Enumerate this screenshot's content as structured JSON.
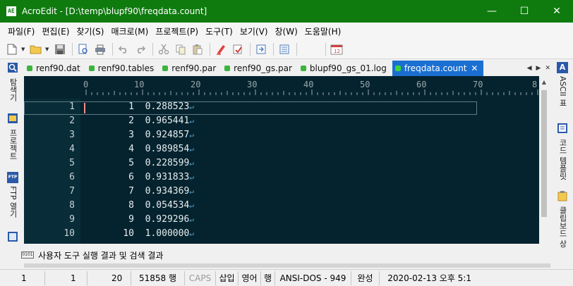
{
  "window": {
    "app_icon_text": "AE",
    "title": "AcroEdit - [D:\\temp\\blupf90\\freqdata.count]",
    "minimize": "—",
    "maximize": "☐",
    "close": "✕"
  },
  "menu": {
    "items": [
      "파일(F)",
      "편집(E)",
      "찾기(S)",
      "매크로(M)",
      "프로젝트(P)",
      "도구(T)",
      "보기(V)",
      "창(W)",
      "도움말(H)"
    ]
  },
  "left_panel": {
    "items": [
      {
        "label": "탐색기",
        "icon": "magnifier-icon"
      },
      {
        "label": "프로젝트",
        "icon": "project-icon"
      },
      {
        "label": "FTP 열기",
        "icon": "ftp-icon"
      }
    ],
    "ftp_icon_text": "FTP"
  },
  "right_panel": {
    "items": [
      {
        "label": "ASCII 표",
        "icon": "ascii-icon"
      },
      {
        "label": "코드 템플릿",
        "icon": "template-icon"
      },
      {
        "label": "클립보드 상",
        "icon": "clipboard-icon"
      }
    ],
    "ascii_icon_text": "A"
  },
  "tabs": [
    {
      "label": "renf90.dat",
      "active": false
    },
    {
      "label": "renf90.tables",
      "active": false
    },
    {
      "label": "renf90.par",
      "active": false
    },
    {
      "label": "renf90_gs.par",
      "active": false
    },
    {
      "label": "blupf90_gs_01.log",
      "active": false
    },
    {
      "label": "freqdata.count",
      "active": true
    }
  ],
  "tab_nav": {
    "prev": "◀",
    "next": "▶",
    "close": "✕"
  },
  "ruler": {
    "labels": [
      "0",
      "10",
      "20",
      "30",
      "40",
      "50",
      "60",
      "70",
      "8"
    ]
  },
  "editor": {
    "line_numbers": [
      "1",
      "2",
      "3",
      "4",
      "5",
      "6",
      "7",
      "8",
      "9",
      "10"
    ],
    "lines": [
      {
        "id": "1",
        "freq": "0.288523"
      },
      {
        "id": "2",
        "freq": "0.965441"
      },
      {
        "id": "3",
        "freq": "0.924857"
      },
      {
        "id": "4",
        "freq": "0.989854"
      },
      {
        "id": "5",
        "freq": "0.228599"
      },
      {
        "id": "6",
        "freq": "0.931833"
      },
      {
        "id": "7",
        "freq": "0.934369"
      },
      {
        "id": "8",
        "freq": "0.054534"
      },
      {
        "id": "9",
        "freq": "0.929296"
      },
      {
        "id": "10",
        "freq": "1.000000"
      }
    ],
    "eol_mark": "↵"
  },
  "output": {
    "icon_text": "0101",
    "label": "사용자 도구 실행 결과 및 검색 결과"
  },
  "status": {
    "line": "1",
    "col": "1",
    "col2": "20",
    "total_lines": "51858 행",
    "caps": "CAPS",
    "insert": "삽입",
    "lang": "영어",
    "mode": "행",
    "encoding": "ANSI-DOS - 949",
    "state": "완성",
    "datetime": "2020-02-13 오후 5:1"
  },
  "colors": {
    "titlebar": "#0f7b0f",
    "editor_bg": "#05232e",
    "active_tab": "#1a6fd1",
    "eol": "#4ea3d9"
  }
}
